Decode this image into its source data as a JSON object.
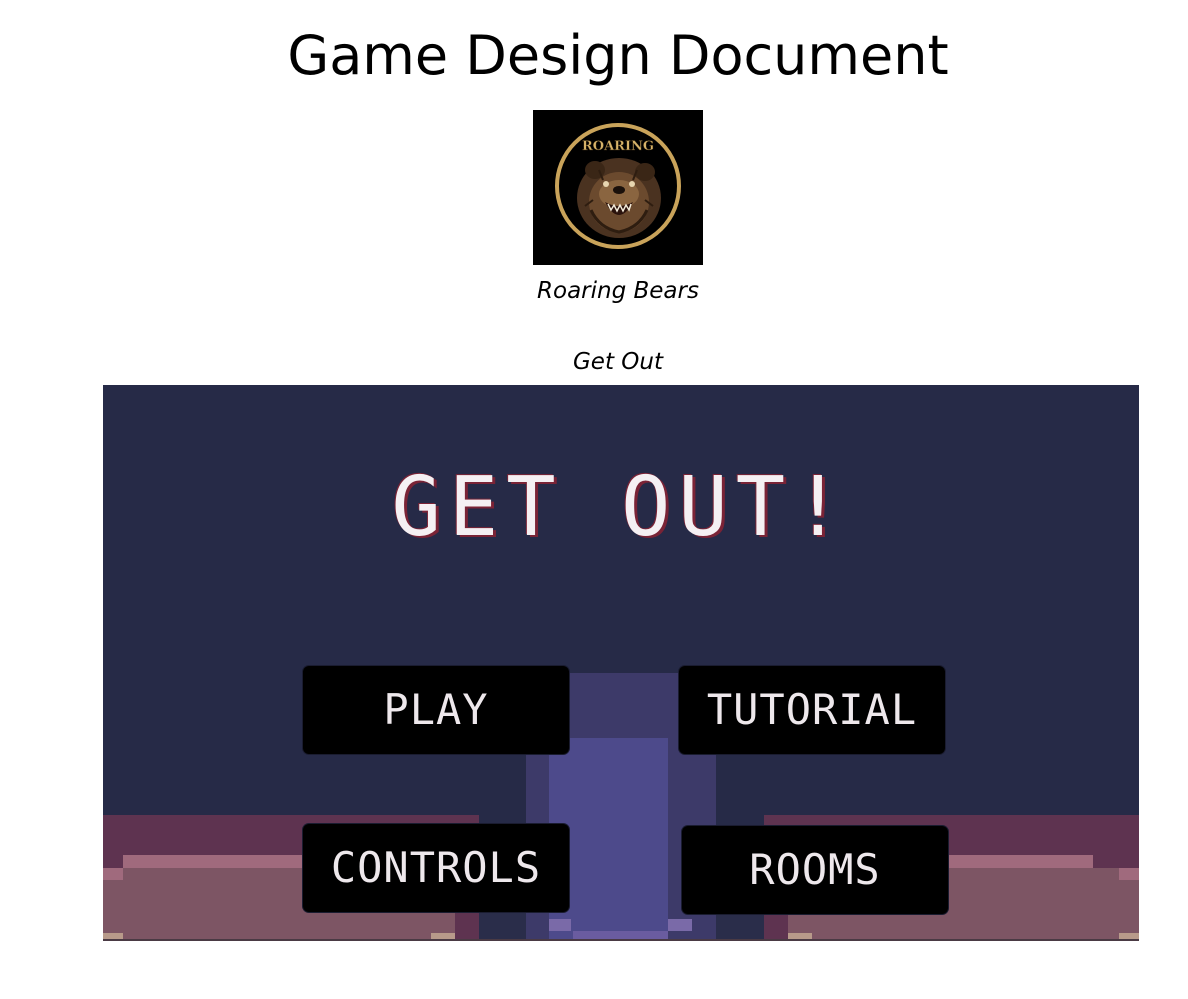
{
  "document": {
    "title": "Game Design Document",
    "team_name": "Roaring Bears",
    "game_name": "Get Out"
  },
  "logo": {
    "text": "ROARING",
    "ring_color": "#c9a35a",
    "background": "#000000"
  },
  "game_screen": {
    "title": "GET OUT!",
    "background_color": "#262a47",
    "title_color": "#f5f0f3",
    "title_shadow_color": "#7a2336",
    "buttons": {
      "play": "PLAY",
      "tutorial": "TUTORIAL",
      "controls": "CONTROLS",
      "rooms": "ROOMS"
    }
  }
}
